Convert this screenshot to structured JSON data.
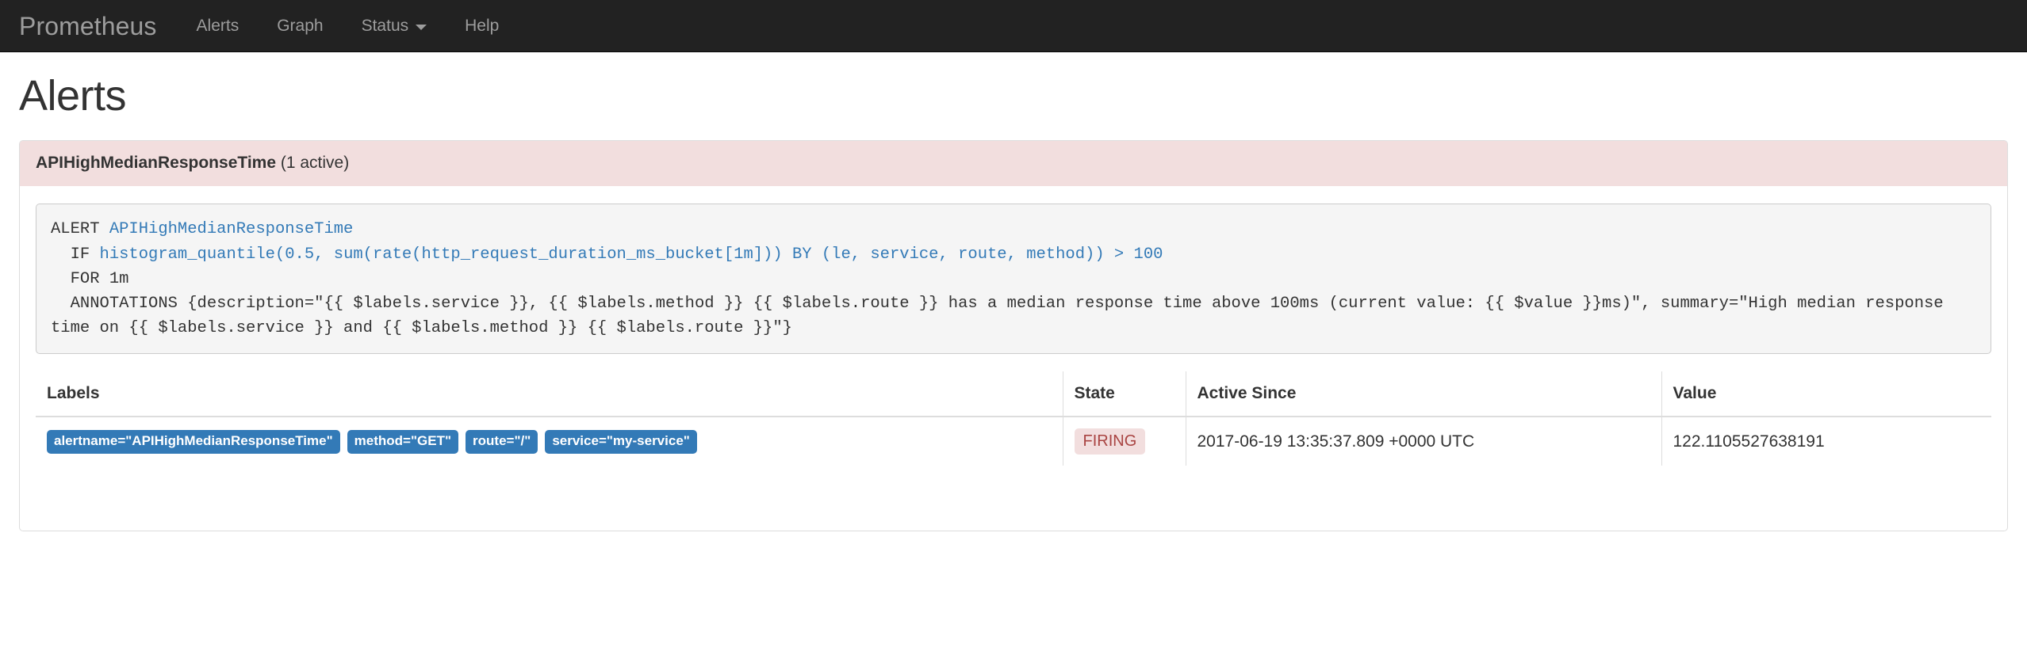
{
  "navbar": {
    "brand": "Prometheus",
    "items": [
      {
        "label": "Alerts",
        "dropdown": false
      },
      {
        "label": "Graph",
        "dropdown": false
      },
      {
        "label": "Status",
        "dropdown": true
      },
      {
        "label": "Help",
        "dropdown": false
      }
    ]
  },
  "page": {
    "title": "Alerts"
  },
  "alert": {
    "name": "APIHighMedianResponseTime",
    "active_text": "(1 active)",
    "rule": {
      "line1_keyword": "ALERT ",
      "line1_name": "APIHighMedianResponseTime",
      "line2_keyword": "  IF ",
      "line2_expr": "histogram_quantile(0.5, sum(rate(http_request_duration_ms_bucket[1m])) BY (le, service, route, method)) > 100",
      "line3": "  FOR 1m",
      "line4": "  ANNOTATIONS {description=\"{{ $labels.service }}, {{ $labels.method }} {{ $labels.route }} has a median response time above 100ms (current value: {{ $value }}ms)\", summary=\"High median response time on {{ $labels.service }} and {{ $labels.method }} {{ $labels.route }}\"}"
    },
    "table": {
      "headers": {
        "labels": "Labels",
        "state": "State",
        "active_since": "Active Since",
        "value": "Value"
      },
      "rows": [
        {
          "labels": [
            "alertname=\"APIHighMedianResponseTime\"",
            "method=\"GET\"",
            "route=\"/\"",
            "service=\"my-service\""
          ],
          "state": "FIRING",
          "active_since": "2017-06-19 13:35:37.809 +0000 UTC",
          "value": "122.1105527638191"
        }
      ]
    }
  },
  "colors": {
    "navbar_bg": "#222222",
    "nav_text": "#9d9d9d",
    "alert_heading_bg": "#f2dede",
    "firing_text": "#a94442",
    "label_badge_bg": "#337ab7",
    "code_bg": "#f5f5f5",
    "link_blue": "#337ab7"
  }
}
